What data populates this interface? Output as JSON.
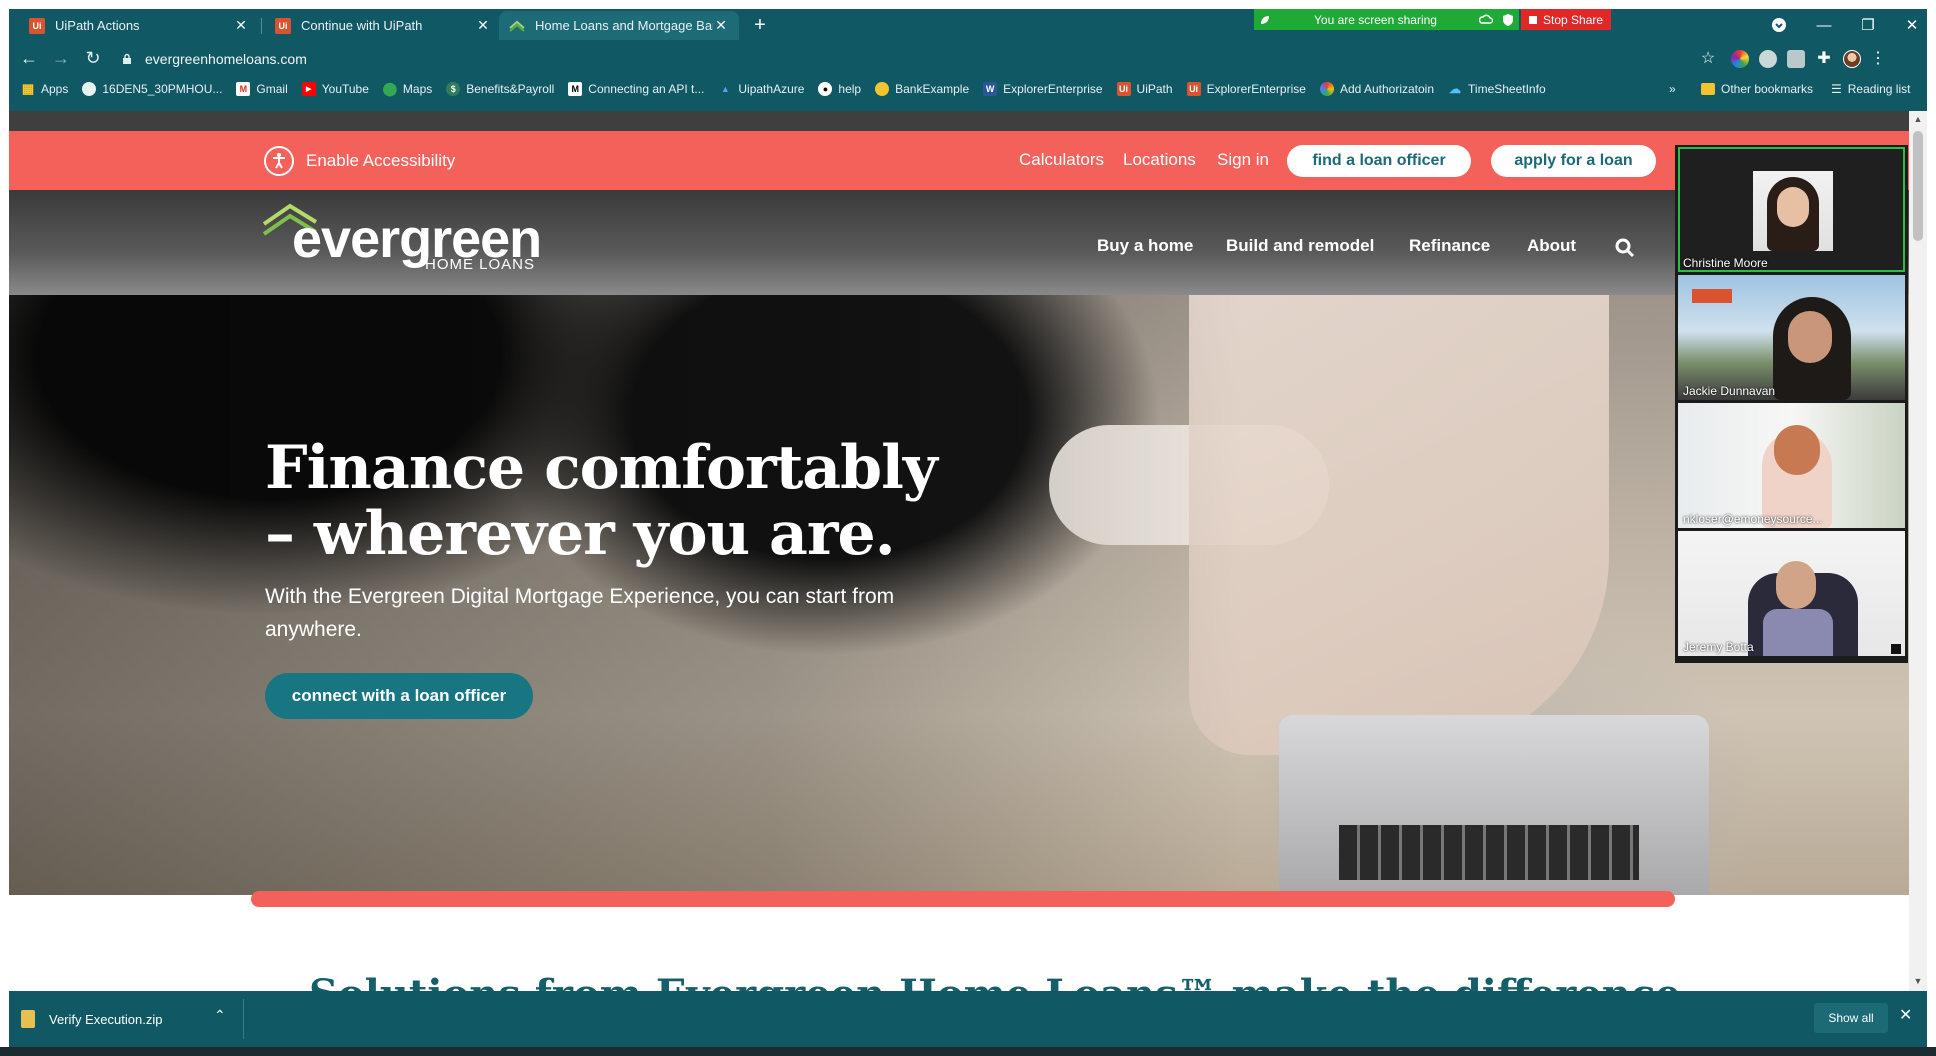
{
  "tabs": [
    {
      "title": "UiPath Actions",
      "favicon": "uipath-icon"
    },
    {
      "title": "Continue with UiPath",
      "favicon": "uipath-icon"
    },
    {
      "title": "Home Loans and Mortgage Bank",
      "favicon": "evergreen-icon"
    }
  ],
  "screen_share": {
    "label": "You are screen sharing",
    "stop_label": "Stop Share",
    "color": "#1faa37",
    "stop_color": "#e02828"
  },
  "address_bar": {
    "url": "evergreenhomeloans.com"
  },
  "bookmarks": [
    {
      "label": "Apps",
      "icon": "apps-grid-icon"
    },
    {
      "label": "16DEN5_30PMHOU...",
      "icon": "globe-icon"
    },
    {
      "label": "Gmail",
      "icon": "gmail-icon"
    },
    {
      "label": "YouTube",
      "icon": "youtube-icon"
    },
    {
      "label": "Maps",
      "icon": "maps-icon"
    },
    {
      "label": "Benefits&Payroll",
      "icon": "payroll-icon"
    },
    {
      "label": "Connecting an API t...",
      "icon": "medium-icon"
    },
    {
      "label": "UipathAzure",
      "icon": "azure-icon"
    },
    {
      "label": "help",
      "icon": "github-icon"
    },
    {
      "label": "BankExample",
      "icon": "bank-icon"
    },
    {
      "label": "ExplorerEnterprise",
      "icon": "word-icon"
    },
    {
      "label": "UiPath",
      "icon": "uipath-icon"
    },
    {
      "label": "ExplorerEnterprise",
      "icon": "uipath-icon"
    },
    {
      "label": "Add Authorizatoin",
      "icon": "puzzle-icon"
    },
    {
      "label": "TimeSheetInfo",
      "icon": "cloud-icon"
    }
  ],
  "bookmarks_right": {
    "more": "»",
    "other": "Other bookmarks",
    "reading": "Reading list"
  },
  "site": {
    "accessibility": "Enable Accessibility",
    "util_links": {
      "calculators": "Calculators",
      "locations": "Locations",
      "signin": "Sign in"
    },
    "find_officer": "find a loan officer",
    "apply": "apply for a loan",
    "logo_word": "evergreen",
    "logo_sub": "HOME LOANS",
    "nav": {
      "buy": "Buy a home",
      "build": "Build and remodel",
      "refinance": "Refinance",
      "about": "About"
    },
    "hero_title": "Finance comfortably – wherever you are.",
    "hero_sub": "With the Evergreen Digital Mortgage Experience, you can start from anywhere.",
    "cta": "connect with a loan officer",
    "solutions_heading": "Solutions from Evergreen Home Loans™ make the difference",
    "brand_coral": "#f3615a",
    "brand_teal": "#177682"
  },
  "participants": [
    {
      "name": "Christine Moore"
    },
    {
      "name": "Jackie Dunnavan"
    },
    {
      "name": "nkloser@emoneysource..."
    },
    {
      "name": "Jeremy Botta"
    }
  ],
  "download": {
    "filename": "Verify Execution.zip",
    "show_all": "Show all"
  }
}
